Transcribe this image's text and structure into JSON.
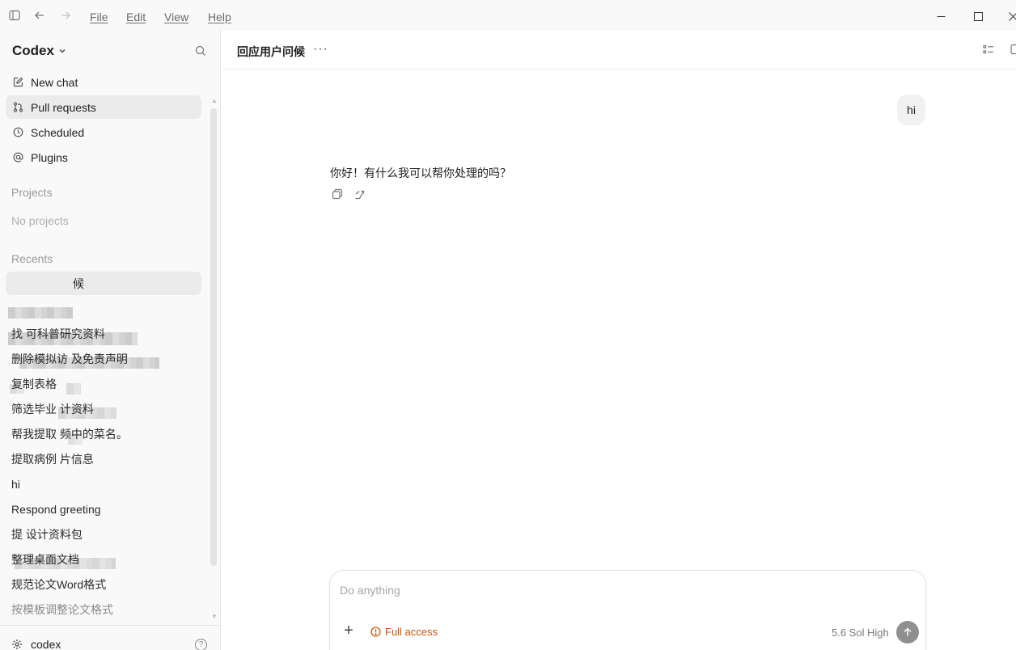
{
  "menu": {
    "file": "File",
    "edit": "Edit",
    "view": "View",
    "help": "Help"
  },
  "sidebar": {
    "brand": "Codex",
    "nav": [
      {
        "label": "New chat",
        "icon": "edit-icon"
      },
      {
        "label": "Pull requests",
        "icon": "git-pull-request-icon"
      },
      {
        "label": "Scheduled",
        "icon": "clock-icon"
      },
      {
        "label": "Plugins",
        "icon": "at-icon"
      }
    ],
    "projects_title": "Projects",
    "projects_empty": "No projects",
    "recents_title": "Recents",
    "recents": [
      "候",
      "",
      "找 可科普研究资料",
      "删除模拟访 及免责声明",
      "复制表格",
      "筛选毕业 计资料",
      "帮我提取 频中的菜名。",
      "提取病例 片信息",
      "hi",
      "Respond greeting",
      "提 设计资料包",
      "整理桌面文档",
      "规范论文Word格式",
      "按模板调整论文格式"
    ],
    "user": "codex"
  },
  "main": {
    "thread_title": "回应用户问候",
    "user_message": "hi",
    "assistant_message": "你好！有什么我可以帮你处理的吗？",
    "composer": {
      "placeholder": "Do anything",
      "access_label": "Full access",
      "model": "5.6 Sol",
      "effort": "High"
    }
  },
  "colors": {
    "accent_warning": "#c9530a",
    "sidebar_bg": "#f9f9f9",
    "active_item": "#ebebeb"
  }
}
